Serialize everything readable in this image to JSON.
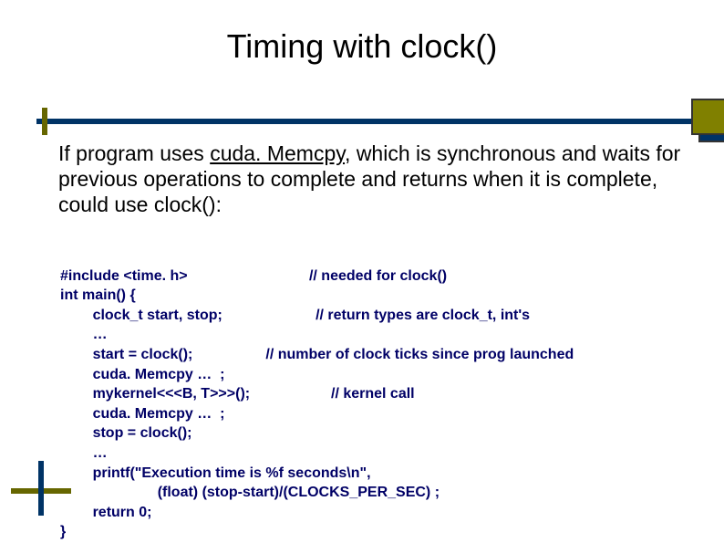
{
  "title": "Timing with clock()",
  "paragraph": {
    "pre": "If program uses ",
    "underlined": "cuda. Memcpy",
    "post": ", which is synchronous and waits for previous operations to complete and returns when it is complete, could use clock():"
  },
  "code": {
    "l01": "#include <time. h>                              // needed for clock()",
    "l02": "int main() {",
    "l03": "        clock_t start, stop;                       // return types are clock_t, int's",
    "l04": "        …",
    "l05": "        start = clock();                  // number of clock ticks since prog launched",
    "l06": "        cuda. Memcpy …  ;",
    "l07": "        mykernel<<<B, T>>>();                    // kernel call",
    "l08": "        cuda. Memcpy …  ;",
    "l09": "        stop = clock();",
    "l10": "        …",
    "l11": "        printf(\"Execution time is %f seconds\\n\",",
    "l12": "                        (float) (stop-start)/(CLOCKS_PER_SEC) ;",
    "l13": "        return 0;",
    "l14": "}"
  }
}
